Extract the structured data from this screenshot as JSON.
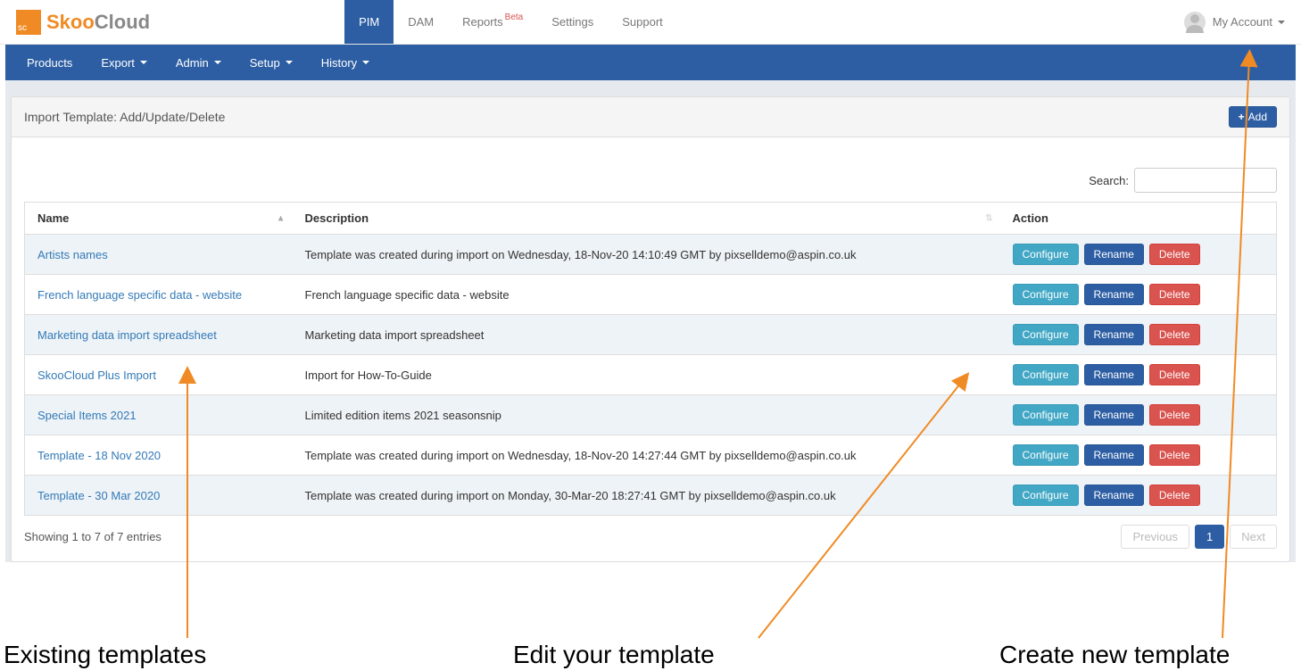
{
  "brand": {
    "badge": "sc",
    "part1": "Skoo",
    "part2": "Cloud"
  },
  "topnav": {
    "items": [
      "PIM",
      "DAM",
      "Reports",
      "Settings",
      "Support"
    ],
    "beta_badge": "Beta",
    "active": "PIM"
  },
  "account": {
    "label": "My Account"
  },
  "subnav": {
    "items": [
      "Products",
      "Export",
      "Admin",
      "Setup",
      "History"
    ],
    "dropdowns": [
      false,
      true,
      true,
      true,
      true
    ]
  },
  "panel": {
    "title": "Import Template: Add/Update/Delete",
    "add_label": "Add"
  },
  "search": {
    "label": "Search:",
    "value": ""
  },
  "table": {
    "columns": [
      "Name",
      "Description",
      "Action"
    ],
    "sort_column": "Name",
    "sort_dir": "asc",
    "rows": [
      {
        "name": "Artists names",
        "description": "Template was created during import on Wednesday, 18-Nov-20 14:10:49 GMT by pixselldemo@aspin.co.uk"
      },
      {
        "name": "French language specific data - website",
        "description": "French language specific data - website"
      },
      {
        "name": "Marketing data import spreadsheet",
        "description": "Marketing data import spreadsheet"
      },
      {
        "name": "SkooCloud Plus Import",
        "description": "Import for How-To-Guide"
      },
      {
        "name": "Special Items 2021",
        "description": "Limited edition items 2021 seasonsnip"
      },
      {
        "name": "Template - 18 Nov 2020",
        "description": "Template was created during import on Wednesday, 18-Nov-20 14:27:44 GMT by pixselldemo@aspin.co.uk"
      },
      {
        "name": "Template - 30 Mar 2020",
        "description": "Template was created during import on Monday, 30-Mar-20 18:27:41 GMT by pixselldemo@aspin.co.uk"
      }
    ],
    "action_buttons": {
      "configure": "Configure",
      "rename": "Rename",
      "delete": "Delete"
    }
  },
  "footer": {
    "info": "Showing 1 to 7 of 7 entries",
    "previous": "Previous",
    "next": "Next",
    "current_page": "1"
  },
  "annotations": {
    "existing": "Existing templates",
    "edit": "Edit your template",
    "create": "Create new template"
  }
}
